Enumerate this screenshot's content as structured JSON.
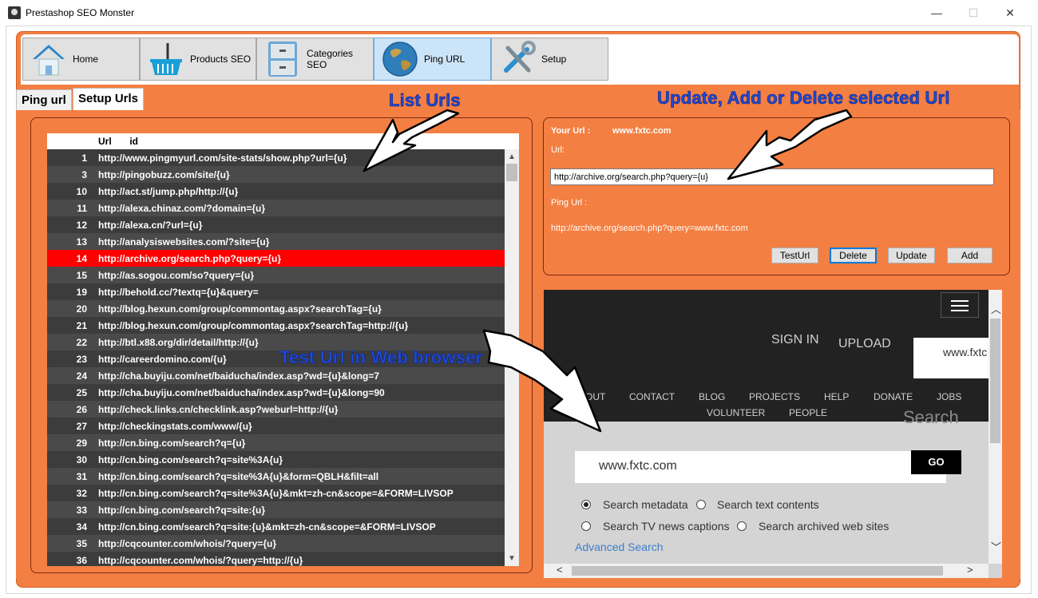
{
  "window": {
    "title": "Prestashop SEO Monster",
    "min": "—",
    "max": "☐",
    "close": "✕"
  },
  "toolbar": [
    {
      "label": "Home",
      "icon": "home-icon"
    },
    {
      "label": "Products SEO",
      "icon": "basket-icon"
    },
    {
      "label": "Categories SEO",
      "icon": "cabinet-icon"
    },
    {
      "label": "Ping URL",
      "icon": "globe-icon",
      "active": true
    },
    {
      "label": "Setup",
      "icon": "tools-icon"
    }
  ],
  "tabs": {
    "ping": "Ping url",
    "setup": "Setup Urls"
  },
  "annotations": {
    "list": "List Urls",
    "update": "Update, Add or Delete selected Url",
    "test": "Test Url in Web browser"
  },
  "grid": {
    "headers": {
      "id": "id",
      "url": "Url"
    },
    "rows": [
      {
        "id": "1",
        "url": "http://www.pingmyurl.com/site-stats/show.php?url={u}"
      },
      {
        "id": "3",
        "url": "http://pingobuzz.com/site/{u}"
      },
      {
        "id": "10",
        "url": "http://act.st/jump.php/http://{u}"
      },
      {
        "id": "11",
        "url": "http://alexa.chinaz.com/?domain={u}"
      },
      {
        "id": "12",
        "url": "http://alexa.cn/?url={u}"
      },
      {
        "id": "13",
        "url": "http://analysiswebsites.com/?site={u}"
      },
      {
        "id": "14",
        "url": "http://archive.org/search.php?query={u}",
        "selected": true
      },
      {
        "id": "15",
        "url": "http://as.sogou.com/so?query={u}"
      },
      {
        "id": "19",
        "url": "http://behold.cc/?textq={u}&query="
      },
      {
        "id": "20",
        "url": "http://blog.hexun.com/group/commontag.aspx?searchTag={u}"
      },
      {
        "id": "21",
        "url": "http://blog.hexun.com/group/commontag.aspx?searchTag=http://{u}"
      },
      {
        "id": "22",
        "url": "http://btl.x88.org/dir/detail/http://{u}"
      },
      {
        "id": "23",
        "url": "http://careerdomino.com/{u}"
      },
      {
        "id": "24",
        "url": "http://cha.buyiju.com/net/baiducha/index.asp?wd={u}&long=7"
      },
      {
        "id": "25",
        "url": "http://cha.buyiju.com/net/baiducha/index.asp?wd={u}&long=90"
      },
      {
        "id": "26",
        "url": "http://check.links.cn/checklink.asp?weburl=http://{u}"
      },
      {
        "id": "27",
        "url": "http://checkingstats.com/www/{u}"
      },
      {
        "id": "29",
        "url": "http://cn.bing.com/search?q={u}"
      },
      {
        "id": "30",
        "url": "http://cn.bing.com/search?q=site%3A{u}"
      },
      {
        "id": "31",
        "url": "http://cn.bing.com/search?q=site%3A{u}&form=QBLH&filt=all"
      },
      {
        "id": "32",
        "url": "http://cn.bing.com/search?q=site%3A{u}&mkt=zh-cn&scope=&FORM=LIVSOP"
      },
      {
        "id": "33",
        "url": "http://cn.bing.com/search?q=site:{u}"
      },
      {
        "id": "34",
        "url": "http://cn.bing.com/search?q=site:{u}&mkt=zh-cn&scope=&FORM=LIVSOP"
      },
      {
        "id": "35",
        "url": "http://cqcounter.com/whois/?query={u}"
      },
      {
        "id": "36",
        "url": "http://cqcounter.com/whois/?query=http://{u}"
      }
    ]
  },
  "edit": {
    "your_url_label": "Your Url :",
    "your_url_value": "www.fxtc.com",
    "url_label": "Url:",
    "url_value": "http://archive.org/search.php?query={u}",
    "ping_url_label": "Ping Url :",
    "ping_url_value": "http://archive.org/search.php?query=www.fxtc.com",
    "buttons": {
      "test": "TestUrl",
      "delete": "Delete",
      "update": "Update",
      "add": "Add"
    }
  },
  "browser": {
    "signin": "SIGN IN",
    "upload": "UPLOAD",
    "box_text": "www.fxtc",
    "nav_row1": [
      "OUT",
      "CONTACT",
      "BLOG",
      "PROJECTS",
      "HELP",
      "DONATE",
      "JOBS"
    ],
    "nav_row2": [
      "VOLUNTEER",
      "PEOPLE"
    ],
    "ghost_heading": "Search",
    "search_value": "www.fxtc.com",
    "go": "GO",
    "options": [
      "Search metadata",
      "Search text contents",
      "Search TV news captions",
      "Search archived web sites"
    ],
    "advanced": "Advanced Search"
  }
}
